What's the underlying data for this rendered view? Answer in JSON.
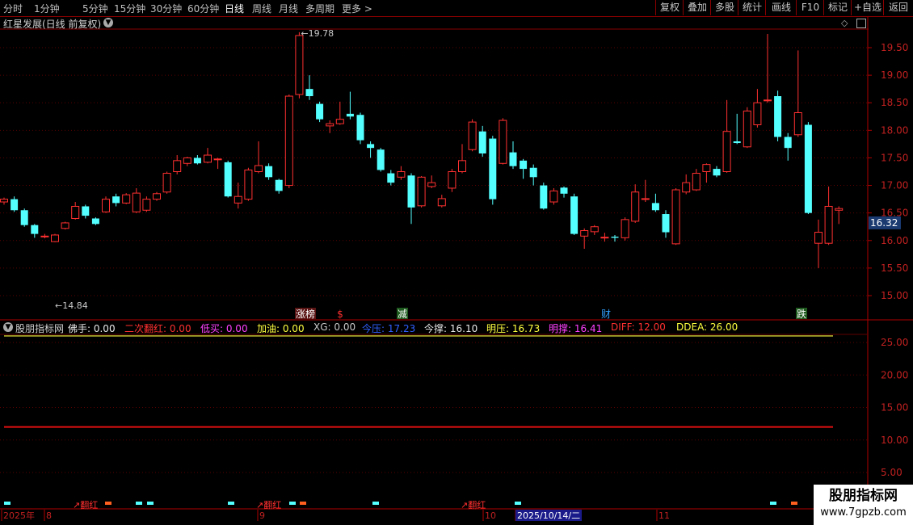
{
  "periods": [
    "分时",
    "1分钟",
    "5分钟",
    "15分钟",
    "30分钟",
    "60分钟",
    "日线",
    "周线",
    "月线",
    "多周期",
    "更多 >"
  ],
  "active_period": "日线",
  "right_buttons": [
    "复权",
    "叠加",
    "多股",
    "统计",
    "画线",
    "F10",
    "标记",
    "+自选",
    "返回"
  ],
  "stock_title": "红星发展(日线 前复权)",
  "price_axis": [
    "19.50",
    "19.00",
    "18.50",
    "18.00",
    "17.50",
    "17.00",
    "16.50",
    "16.00",
    "15.50",
    "15.00"
  ],
  "current_price": "16.32",
  "high_label": "19.78",
  "low_label": "14.84",
  "event_markers": [
    "涨榜",
    "$",
    "减",
    "财",
    "跌"
  ],
  "indicator": {
    "name": "股朋指标网",
    "fields": [
      {
        "label": "佛手:",
        "value": "0.00",
        "color": "#e8e8e8"
      },
      {
        "label": "二次翻红:",
        "value": "0.00",
        "color": "#ff3030"
      },
      {
        "label": "低买:",
        "value": "0.00",
        "color": "#ff40ff"
      },
      {
        "label": "加油:",
        "value": "0.00",
        "color": "#ffff40"
      },
      {
        "label": "XG:",
        "value": "0.00",
        "color": "#c8c8c8"
      },
      {
        "label": "今压:",
        "value": "17.23",
        "color": "#3060ff"
      },
      {
        "label": "今撑:",
        "value": "16.10",
        "color": "#e8e8e8"
      },
      {
        "label": "明压:",
        "value": "16.73",
        "color": "#ffff40"
      },
      {
        "label": "明撑:",
        "value": "16.41",
        "color": "#ff40ff"
      },
      {
        "label": "DIFF:",
        "value": "12.00",
        "color": "#ff3030"
      },
      {
        "label": "DDEA:",
        "value": "26.00",
        "color": "#ffff40"
      }
    ]
  },
  "ind_axis": [
    "25.00",
    "20.00",
    "15.00",
    "10.00",
    "5.00"
  ],
  "fanhong_labels": [
    "翻红",
    "翻红",
    "翻红"
  ],
  "date_labels": [
    "2025年",
    "8",
    "9",
    "10",
    "2025/10/14/二",
    "11"
  ],
  "watermark": {
    "line1": "股朋指标网",
    "line2": "www.7gpzb.com"
  },
  "chart_data": {
    "type": "candlestick",
    "ylim": [
      14.8,
      19.85
    ],
    "candles": [
      [
        0,
        16.7,
        16.75,
        16.78,
        16.65
      ],
      [
        1,
        16.75,
        16.55,
        16.8,
        16.52
      ],
      [
        2,
        16.55,
        16.28,
        16.58,
        16.25
      ],
      [
        3,
        16.28,
        16.12,
        16.3,
        16.05
      ],
      [
        4,
        16.08,
        16.08,
        16.12,
        16.04
      ],
      [
        5,
        15.98,
        16.1,
        16.12,
        15.97
      ],
      [
        6,
        16.22,
        16.32,
        16.34,
        16.2
      ],
      [
        7,
        16.4,
        16.62,
        16.7,
        16.38
      ],
      [
        8,
        16.62,
        16.45,
        16.65,
        16.4
      ],
      [
        9,
        16.4,
        16.3,
        16.42,
        16.28
      ],
      [
        10,
        16.52,
        16.75,
        16.8,
        16.5
      ],
      [
        11,
        16.8,
        16.68,
        16.85,
        16.62
      ],
      [
        12,
        16.68,
        16.83,
        16.86,
        16.66
      ],
      [
        13,
        16.52,
        16.86,
        16.95,
        16.5
      ],
      [
        14,
        16.55,
        16.75,
        16.8,
        16.52
      ],
      [
        15,
        16.75,
        16.85,
        16.88,
        16.72
      ],
      [
        16,
        16.88,
        17.22,
        17.25,
        16.85
      ],
      [
        17,
        17.25,
        17.45,
        17.55,
        17.2
      ],
      [
        18,
        17.4,
        17.5,
        17.52,
        17.35
      ],
      [
        19,
        17.5,
        17.4,
        17.55,
        17.38
      ],
      [
        20,
        17.42,
        17.55,
        17.68,
        17.4
      ],
      [
        21,
        17.48,
        17.48,
        17.5,
        17.3
      ],
      [
        22,
        17.42,
        16.8,
        17.45,
        16.78
      ],
      [
        23,
        16.68,
        16.8,
        17.05,
        16.58
      ],
      [
        24,
        16.75,
        17.28,
        17.32,
        16.72
      ],
      [
        25,
        17.25,
        17.36,
        17.8,
        17.22
      ],
      [
        26,
        17.35,
        17.15,
        17.4,
        17.1
      ],
      [
        27,
        17.1,
        16.9,
        17.12,
        16.85
      ],
      [
        28,
        17.0,
        18.62,
        18.65,
        16.95
      ],
      [
        29,
        18.65,
        19.72,
        19.78,
        18.58
      ],
      [
        30,
        18.75,
        18.62,
        19.0,
        18.55
      ],
      [
        31,
        18.48,
        18.2,
        18.52,
        18.15
      ],
      [
        32,
        18.08,
        18.12,
        18.18,
        17.95
      ],
      [
        33,
        18.12,
        18.2,
        18.52,
        18.1
      ],
      [
        34,
        18.3,
        18.25,
        18.7,
        18.2
      ],
      [
        35,
        18.28,
        17.82,
        18.32,
        17.75
      ],
      [
        36,
        17.75,
        17.68,
        17.8,
        17.5
      ],
      [
        37,
        17.65,
        17.28,
        17.68,
        17.25
      ],
      [
        38,
        17.22,
        17.05,
        17.28,
        17.0
      ],
      [
        39,
        17.15,
        17.25,
        17.35,
        17.1
      ],
      [
        40,
        17.18,
        16.6,
        17.22,
        16.3
      ],
      [
        41,
        16.63,
        17.15,
        17.17,
        16.6
      ],
      [
        42,
        16.98,
        17.05,
        17.18,
        16.95
      ],
      [
        43,
        16.63,
        16.76,
        16.83,
        16.6
      ],
      [
        44,
        16.95,
        17.25,
        17.3,
        16.88
      ],
      [
        45,
        17.25,
        17.45,
        17.75,
        17.22
      ],
      [
        46,
        17.65,
        18.15,
        18.2,
        17.62
      ],
      [
        47,
        17.98,
        17.58,
        18.08,
        17.52
      ],
      [
        48,
        17.85,
        16.75,
        17.9,
        16.65
      ],
      [
        49,
        17.4,
        18.18,
        18.22,
        17.38
      ],
      [
        50,
        17.6,
        17.35,
        17.8,
        17.3
      ],
      [
        51,
        17.45,
        17.3,
        17.48,
        17.12
      ],
      [
        52,
        17.32,
        17.15,
        17.38,
        17.0
      ],
      [
        53,
        17.0,
        16.58,
        17.05,
        16.56
      ],
      [
        54,
        16.7,
        16.9,
        16.95,
        16.65
      ],
      [
        55,
        16.96,
        16.85,
        16.98,
        16.78
      ],
      [
        56,
        16.8,
        16.12,
        16.85,
        16.1
      ],
      [
        57,
        16.08,
        16.18,
        16.22,
        15.85
      ],
      [
        58,
        16.16,
        16.25,
        16.28,
        16.1
      ],
      [
        59,
        16.05,
        16.06,
        16.14,
        15.98
      ],
      [
        60,
        16.07,
        16.05,
        16.1,
        15.98
      ],
      [
        61,
        16.05,
        16.38,
        16.42,
        16.0
      ],
      [
        62,
        16.35,
        16.88,
        17.02,
        16.32
      ],
      [
        63,
        16.75,
        16.76,
        17.1,
        16.7
      ],
      [
        64,
        16.68,
        16.55,
        16.85,
        16.52
      ],
      [
        65,
        16.48,
        16.15,
        16.55,
        16.05
      ],
      [
        66,
        15.94,
        16.92,
        16.95,
        15.92
      ],
      [
        67,
        16.88,
        17.05,
        17.2,
        16.84
      ],
      [
        68,
        16.92,
        17.22,
        17.3,
        16.9
      ],
      [
        69,
        17.25,
        17.38,
        17.4,
        17.05
      ],
      [
        70,
        17.3,
        17.18,
        17.35,
        17.15
      ],
      [
        71,
        17.25,
        17.98,
        18.55,
        17.23
      ],
      [
        72,
        17.8,
        17.77,
        18.3,
        17.75
      ],
      [
        73,
        17.7,
        18.35,
        18.42,
        17.68
      ],
      [
        74,
        18.1,
        18.5,
        18.75,
        18.05
      ],
      [
        75,
        18.55,
        18.55,
        19.75,
        18.5
      ],
      [
        76,
        18.62,
        17.88,
        18.72,
        17.8
      ],
      [
        77,
        17.88,
        17.68,
        17.95,
        17.45
      ],
      [
        78,
        17.92,
        18.32,
        19.45,
        17.88
      ],
      [
        79,
        18.1,
        16.5,
        18.15,
        16.48
      ],
      [
        80,
        15.95,
        16.15,
        16.38,
        15.5
      ],
      [
        81,
        15.95,
        16.62,
        16.98,
        15.92
      ],
      [
        82,
        16.55,
        16.58,
        16.62,
        16.3
      ]
    ],
    "indicator_lines": [
      {
        "name": "DIFF",
        "value": 12.0
      },
      {
        "name": "DDEA",
        "value": 26.0
      }
    ],
    "indicator_ylim": [
      3,
      28
    ]
  }
}
